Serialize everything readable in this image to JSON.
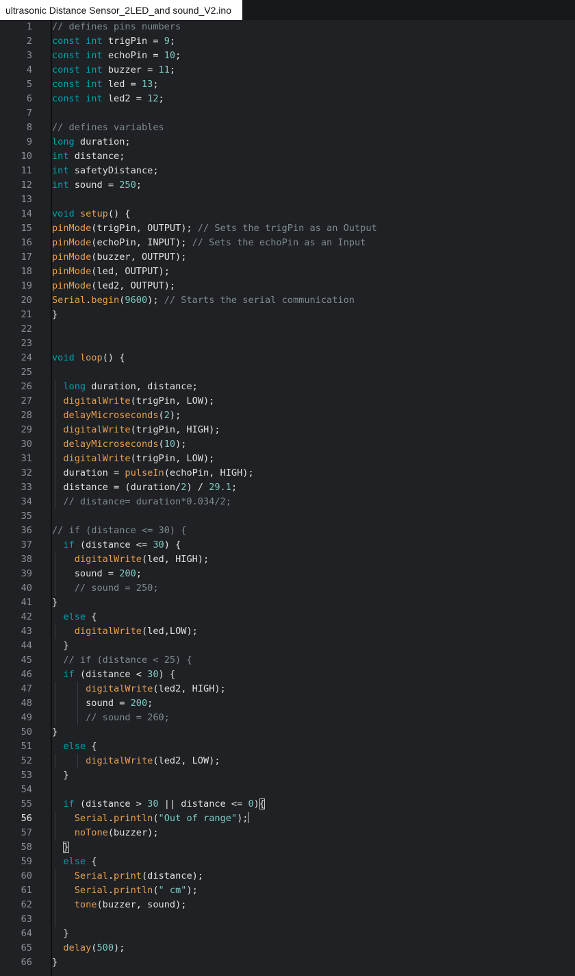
{
  "tab": {
    "title": "ultrasonic Distance Sensor_2LED_and sound_V2.ino"
  },
  "editor": {
    "active_line": 56,
    "lines": [
      {
        "n": 1,
        "t": [
          [
            "cm",
            "// defines pins numbers"
          ]
        ]
      },
      {
        "n": 2,
        "t": [
          [
            "kw",
            "const"
          ],
          [
            "p",
            " "
          ],
          [
            "kw",
            "int"
          ],
          [
            "p",
            " trigPin = "
          ],
          [
            "num",
            "9"
          ],
          [
            "p",
            ";"
          ]
        ]
      },
      {
        "n": 3,
        "t": [
          [
            "kw",
            "const"
          ],
          [
            "p",
            " "
          ],
          [
            "kw",
            "int"
          ],
          [
            "p",
            " echoPin = "
          ],
          [
            "num",
            "10"
          ],
          [
            "p",
            ";"
          ]
        ]
      },
      {
        "n": 4,
        "t": [
          [
            "kw",
            "const"
          ],
          [
            "p",
            " "
          ],
          [
            "kw",
            "int"
          ],
          [
            "p",
            " buzzer = "
          ],
          [
            "num",
            "11"
          ],
          [
            "p",
            ";"
          ]
        ]
      },
      {
        "n": 5,
        "t": [
          [
            "kw",
            "const"
          ],
          [
            "p",
            " "
          ],
          [
            "kw",
            "int"
          ],
          [
            "p",
            " led = "
          ],
          [
            "num",
            "13"
          ],
          [
            "p",
            ";"
          ]
        ]
      },
      {
        "n": 6,
        "t": [
          [
            "kw",
            "const"
          ],
          [
            "p",
            " "
          ],
          [
            "kw",
            "int"
          ],
          [
            "p",
            " led2 = "
          ],
          [
            "num",
            "12"
          ],
          [
            "p",
            ";"
          ]
        ]
      },
      {
        "n": 7,
        "t": []
      },
      {
        "n": 8,
        "t": [
          [
            "cm",
            "// defines variables"
          ]
        ]
      },
      {
        "n": 9,
        "t": [
          [
            "kw",
            "long"
          ],
          [
            "p",
            " duration;"
          ]
        ]
      },
      {
        "n": 10,
        "t": [
          [
            "kw",
            "int"
          ],
          [
            "p",
            " distance;"
          ]
        ]
      },
      {
        "n": 11,
        "t": [
          [
            "kw",
            "int"
          ],
          [
            "p",
            " safetyDistance;"
          ]
        ]
      },
      {
        "n": 12,
        "t": [
          [
            "kw",
            "int"
          ],
          [
            "p",
            " sound = "
          ],
          [
            "num",
            "250"
          ],
          [
            "p",
            ";"
          ]
        ]
      },
      {
        "n": 13,
        "t": []
      },
      {
        "n": 14,
        "t": [
          [
            "kw",
            "void"
          ],
          [
            "p",
            " "
          ],
          [
            "fn",
            "setup"
          ],
          [
            "p",
            "() {"
          ]
        ]
      },
      {
        "n": 15,
        "t": [
          [
            "fn",
            "pinMode"
          ],
          [
            "p",
            "(trigPin, OUTPUT); "
          ],
          [
            "cm",
            "// Sets the trigPin as an Output"
          ]
        ]
      },
      {
        "n": 16,
        "t": [
          [
            "fn",
            "pinMode"
          ],
          [
            "p",
            "(echoPin, INPUT); "
          ],
          [
            "cm",
            "// Sets the echoPin as an Input"
          ]
        ]
      },
      {
        "n": 17,
        "t": [
          [
            "fn",
            "pinMode"
          ],
          [
            "p",
            "(buzzer, OUTPUT);"
          ]
        ]
      },
      {
        "n": 18,
        "t": [
          [
            "fn",
            "pinMode"
          ],
          [
            "p",
            "(led, OUTPUT);"
          ]
        ]
      },
      {
        "n": 19,
        "t": [
          [
            "fn",
            "pinMode"
          ],
          [
            "p",
            "(led2, OUTPUT);"
          ]
        ]
      },
      {
        "n": 20,
        "t": [
          [
            "fn",
            "Serial"
          ],
          [
            "p",
            "."
          ],
          [
            "fn",
            "begin"
          ],
          [
            "p",
            "("
          ],
          [
            "num",
            "9600"
          ],
          [
            "p",
            "); "
          ],
          [
            "cm",
            "// Starts the serial communication"
          ]
        ]
      },
      {
        "n": 21,
        "t": [
          [
            "p",
            "}"
          ]
        ]
      },
      {
        "n": 22,
        "t": []
      },
      {
        "n": 23,
        "t": []
      },
      {
        "n": 24,
        "t": [
          [
            "kw",
            "void"
          ],
          [
            "p",
            " "
          ],
          [
            "fn",
            "loop"
          ],
          [
            "p",
            "() {"
          ]
        ]
      },
      {
        "n": 25,
        "t": []
      },
      {
        "n": 26,
        "t": [
          [
            "p",
            "  "
          ],
          [
            "kw",
            "long"
          ],
          [
            "p",
            " duration, distance;"
          ]
        ]
      },
      {
        "n": 27,
        "t": [
          [
            "p",
            "  "
          ],
          [
            "fn",
            "digitalWrite"
          ],
          [
            "p",
            "(trigPin, LOW);"
          ]
        ]
      },
      {
        "n": 28,
        "t": [
          [
            "p",
            "  "
          ],
          [
            "fn",
            "delayMicroseconds"
          ],
          [
            "p",
            "("
          ],
          [
            "num",
            "2"
          ],
          [
            "p",
            ");"
          ]
        ]
      },
      {
        "n": 29,
        "t": [
          [
            "p",
            "  "
          ],
          [
            "fn",
            "digitalWrite"
          ],
          [
            "p",
            "(trigPin, HIGH);"
          ]
        ]
      },
      {
        "n": 30,
        "t": [
          [
            "p",
            "  "
          ],
          [
            "fn",
            "delayMicroseconds"
          ],
          [
            "p",
            "("
          ],
          [
            "num",
            "10"
          ],
          [
            "p",
            ");"
          ]
        ]
      },
      {
        "n": 31,
        "t": [
          [
            "p",
            "  "
          ],
          [
            "fn",
            "digitalWrite"
          ],
          [
            "p",
            "(trigPin, LOW);"
          ]
        ]
      },
      {
        "n": 32,
        "t": [
          [
            "p",
            "  duration = "
          ],
          [
            "fn",
            "pulseIn"
          ],
          [
            "p",
            "(echoPin, HIGH);"
          ]
        ]
      },
      {
        "n": 33,
        "t": [
          [
            "p",
            "  distance = (duration/"
          ],
          [
            "num",
            "2"
          ],
          [
            "p",
            ") / "
          ],
          [
            "num",
            "29.1"
          ],
          [
            "p",
            ";"
          ]
        ]
      },
      {
        "n": 34,
        "t": [
          [
            "p",
            "  "
          ],
          [
            "cm",
            "// distance= duration*0.034/2;"
          ]
        ]
      },
      {
        "n": 35,
        "t": []
      },
      {
        "n": 36,
        "t": [
          [
            "cm",
            "// if (distance <= 30) {"
          ]
        ]
      },
      {
        "n": 37,
        "t": [
          [
            "p",
            "  "
          ],
          [
            "kw",
            "if"
          ],
          [
            "p",
            " (distance <= "
          ],
          [
            "num",
            "30"
          ],
          [
            "p",
            ") {"
          ]
        ]
      },
      {
        "n": 38,
        "t": [
          [
            "p",
            "    "
          ],
          [
            "fn",
            "digitalWrite"
          ],
          [
            "p",
            "(led, HIGH);"
          ]
        ]
      },
      {
        "n": 39,
        "t": [
          [
            "p",
            "    sound = "
          ],
          [
            "num",
            "200"
          ],
          [
            "p",
            ";"
          ]
        ]
      },
      {
        "n": 40,
        "t": [
          [
            "p",
            "    "
          ],
          [
            "cm",
            "// sound = 250;"
          ]
        ]
      },
      {
        "n": 41,
        "t": [
          [
            "p",
            "}"
          ]
        ]
      },
      {
        "n": 42,
        "t": [
          [
            "p",
            "  "
          ],
          [
            "kw",
            "else"
          ],
          [
            "p",
            " {"
          ]
        ]
      },
      {
        "n": 43,
        "t": [
          [
            "p",
            "    "
          ],
          [
            "fn",
            "digitalWrite"
          ],
          [
            "p",
            "(led,LOW);"
          ]
        ]
      },
      {
        "n": 44,
        "t": [
          [
            "p",
            "  }"
          ]
        ]
      },
      {
        "n": 45,
        "t": [
          [
            "p",
            "  "
          ],
          [
            "cm",
            "// if (distance < 25) {"
          ]
        ]
      },
      {
        "n": 46,
        "t": [
          [
            "p",
            "  "
          ],
          [
            "kw",
            "if"
          ],
          [
            "p",
            " (distance < "
          ],
          [
            "num",
            "30"
          ],
          [
            "p",
            ") {"
          ]
        ]
      },
      {
        "n": 47,
        "t": [
          [
            "p",
            "      "
          ],
          [
            "fn",
            "digitalWrite"
          ],
          [
            "p",
            "(led2, HIGH);"
          ]
        ]
      },
      {
        "n": 48,
        "t": [
          [
            "p",
            "      sound = "
          ],
          [
            "num",
            "200"
          ],
          [
            "p",
            ";"
          ]
        ]
      },
      {
        "n": 49,
        "t": [
          [
            "p",
            "      "
          ],
          [
            "cm",
            "// sound = 260;"
          ]
        ]
      },
      {
        "n": 50,
        "t": [
          [
            "p",
            "}"
          ]
        ]
      },
      {
        "n": 51,
        "t": [
          [
            "p",
            "  "
          ],
          [
            "kw",
            "else"
          ],
          [
            "p",
            " {"
          ]
        ]
      },
      {
        "n": 52,
        "t": [
          [
            "p",
            "      "
          ],
          [
            "fn",
            "digitalWrite"
          ],
          [
            "p",
            "(led2, LOW);"
          ]
        ]
      },
      {
        "n": 53,
        "t": [
          [
            "p",
            "  }"
          ]
        ]
      },
      {
        "n": 54,
        "t": []
      },
      {
        "n": 55,
        "t": [
          [
            "p",
            "  "
          ],
          [
            "kw",
            "if"
          ],
          [
            "p",
            " (distance > "
          ],
          [
            "num",
            "30"
          ],
          [
            "p",
            " || distance <= "
          ],
          [
            "num",
            "0"
          ],
          [
            "p",
            ")"
          ],
          [
            "br",
            "{"
          ]
        ]
      },
      {
        "n": 56,
        "t": [
          [
            "p",
            "    "
          ],
          [
            "fn",
            "Serial"
          ],
          [
            "p",
            "."
          ],
          [
            "fn",
            "println"
          ],
          [
            "p",
            "("
          ],
          [
            "str",
            "\"Out of range\""
          ],
          [
            "p",
            ");"
          ],
          [
            "cur",
            ""
          ]
        ]
      },
      {
        "n": 57,
        "t": [
          [
            "p",
            "    "
          ],
          [
            "fn",
            "noTone"
          ],
          [
            "p",
            "(buzzer);"
          ]
        ]
      },
      {
        "n": 58,
        "t": [
          [
            "p",
            "  "
          ],
          [
            "br",
            "}"
          ]
        ]
      },
      {
        "n": 59,
        "t": [
          [
            "p",
            "  "
          ],
          [
            "kw",
            "else"
          ],
          [
            "p",
            " {"
          ]
        ]
      },
      {
        "n": 60,
        "t": [
          [
            "p",
            "    "
          ],
          [
            "fn",
            "Serial"
          ],
          [
            "p",
            "."
          ],
          [
            "fn",
            "print"
          ],
          [
            "p",
            "(distance);"
          ]
        ]
      },
      {
        "n": 61,
        "t": [
          [
            "p",
            "    "
          ],
          [
            "fn",
            "Serial"
          ],
          [
            "p",
            "."
          ],
          [
            "fn",
            "println"
          ],
          [
            "p",
            "("
          ],
          [
            "str",
            "\" cm\""
          ],
          [
            "p",
            ");"
          ]
        ]
      },
      {
        "n": 62,
        "t": [
          [
            "p",
            "    "
          ],
          [
            "fn",
            "tone"
          ],
          [
            "p",
            "(buzzer, sound);"
          ]
        ]
      },
      {
        "n": 63,
        "t": []
      },
      {
        "n": 64,
        "t": [
          [
            "p",
            "  }"
          ]
        ]
      },
      {
        "n": 65,
        "t": [
          [
            "p",
            "  "
          ],
          [
            "fn",
            "delay"
          ],
          [
            "p",
            "("
          ],
          [
            "num",
            "500"
          ],
          [
            "p",
            ");"
          ]
        ]
      },
      {
        "n": 66,
        "t": [
          [
            "p",
            "}"
          ]
        ]
      }
    ]
  }
}
